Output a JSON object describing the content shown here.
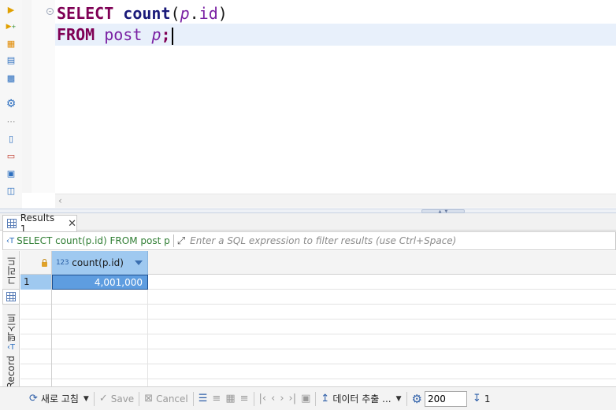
{
  "editor": {
    "lines": [
      {
        "tokens": [
          {
            "text": "SELECT",
            "cls": "kw"
          },
          {
            "text": " ",
            "cls": "plain"
          },
          {
            "text": "count",
            "cls": "fn"
          },
          {
            "text": "(",
            "cls": "plain"
          },
          {
            "text": "p",
            "cls": "alias"
          },
          {
            "text": ".",
            "cls": "plain"
          },
          {
            "text": "id",
            "cls": "ident"
          },
          {
            "text": ")",
            "cls": "plain"
          }
        ]
      },
      {
        "tokens": [
          {
            "text": "FROM",
            "cls": "kw"
          },
          {
            "text": " ",
            "cls": "plain"
          },
          {
            "text": "post",
            "cls": "ident"
          },
          {
            "text": " ",
            "cls": "plain"
          },
          {
            "text": "p",
            "cls": "alias"
          },
          {
            "text": ";",
            "cls": "punct"
          }
        ]
      }
    ],
    "fold_marker": "⊖"
  },
  "left_toolbar": {
    "icons": [
      "run-statement-icon",
      "run-script-icon",
      "explain-plan-icon",
      "load-script-icon",
      "terminal-icon",
      "settings-icon",
      "more-dots-icon",
      "export-icon",
      "delete-icon",
      "format-icon",
      "layout-icon"
    ]
  },
  "results": {
    "tab_label": "Results 1",
    "query_label": "SELECT count(p.id) FROM post p",
    "filter_placeholder": "Enter a SQL expression to filter results (use Ctrl+Space)",
    "side_tabs": [
      "그리드",
      "텍스트",
      "Record"
    ],
    "column": {
      "type_badge": "123",
      "name": "count(p.id)"
    },
    "rows": [
      {
        "num": "1",
        "value": "4,001,000"
      }
    ]
  },
  "bottom_toolbar": {
    "refresh_label": "새로 고침",
    "save_label": "Save",
    "cancel_label": "Cancel",
    "export_label": "데이터 추출 ...",
    "fetch_size": "200",
    "row_count": "1"
  },
  "colors": {
    "keyword": "#7f0055",
    "identifier": "#7a21a3",
    "selection": "#5e9de0",
    "header_selected": "#9fc9f0",
    "query_text": "#2e7d32"
  }
}
